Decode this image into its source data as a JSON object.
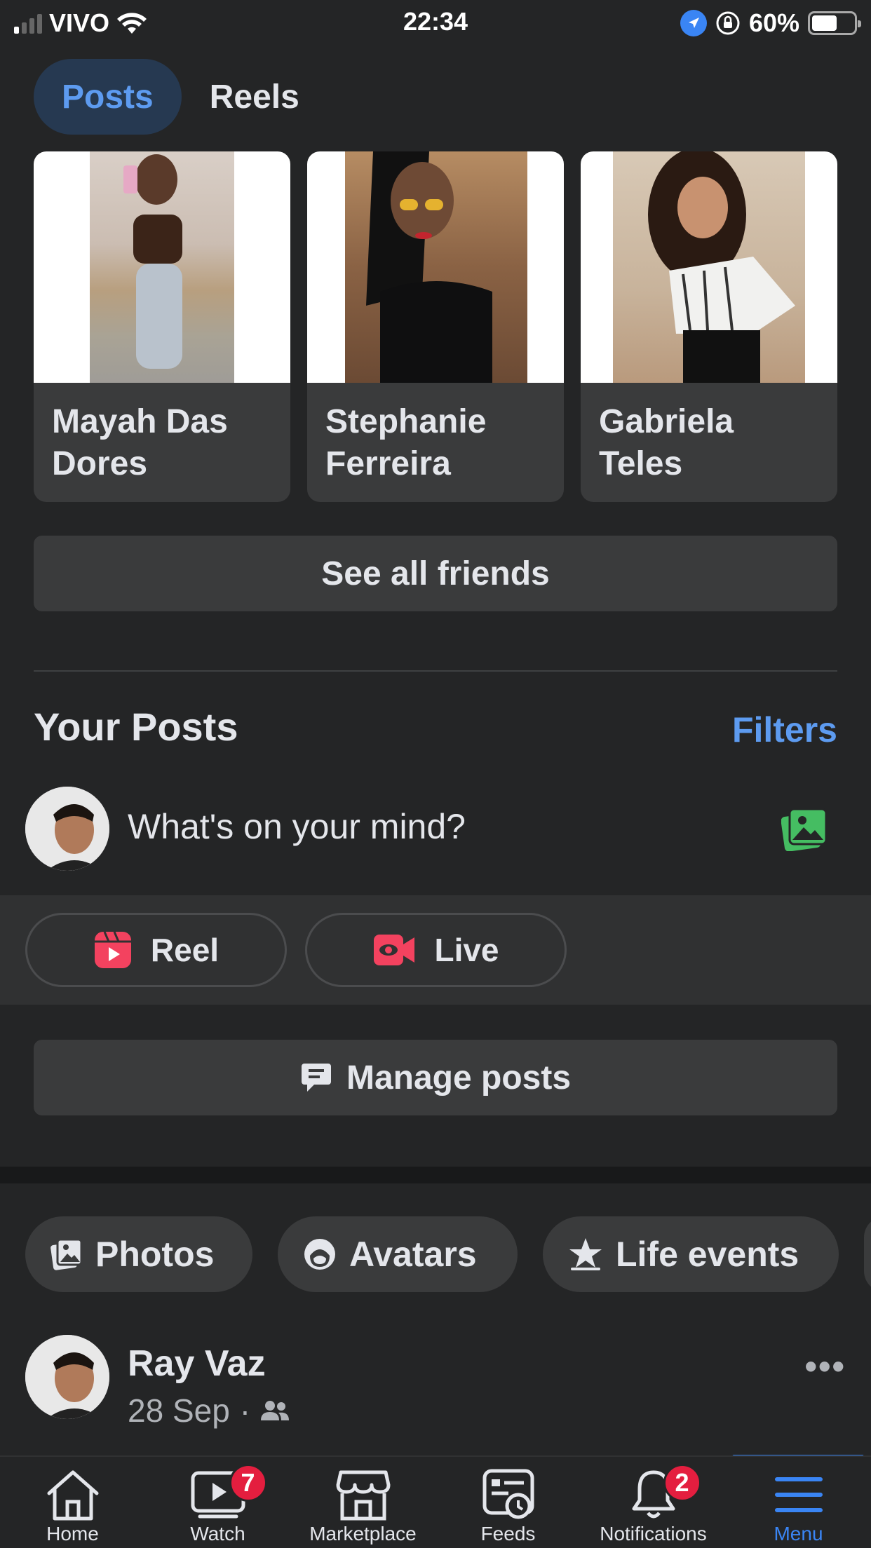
{
  "status_bar": {
    "carrier": "VIVO",
    "time": "22:34",
    "battery": "60%",
    "battery_level": 0.6
  },
  "tabs": [
    {
      "label": "Posts",
      "active": true
    },
    {
      "label": "Reels",
      "active": false
    }
  ],
  "friends": [
    {
      "name_line1": "Mayah Das",
      "name_line2": "Dores"
    },
    {
      "name_line1": "Stephanie",
      "name_line2": "Ferreira"
    },
    {
      "name_line1": "Gabriela",
      "name_line2": "Teles"
    }
  ],
  "see_all_friends": "See all friends",
  "your_posts": {
    "title": "Your Posts",
    "filters": "Filters"
  },
  "composer": {
    "placeholder": "What's on your mind?"
  },
  "actions": {
    "reel": "Reel",
    "live": "Live"
  },
  "manage_posts": "Manage posts",
  "chips": [
    {
      "label": "Photos"
    },
    {
      "label": "Avatars"
    },
    {
      "label": "Life events"
    }
  ],
  "post": {
    "author": "Ray Vaz",
    "date": "28 Sep",
    "separator": "·"
  },
  "bottom_nav": [
    {
      "label": "Home"
    },
    {
      "label": "Watch",
      "badge": "7"
    },
    {
      "label": "Marketplace"
    },
    {
      "label": "Feeds"
    },
    {
      "label": "Notifications",
      "badge": "2"
    },
    {
      "label": "Menu",
      "active": true
    }
  ],
  "colors": {
    "background": "#242526",
    "card": "#3a3b3c",
    "accent": "#5d9bf0",
    "badge": "#e41e3f",
    "reel_icon": "#f3425f",
    "photo_icon": "#45bd62"
  }
}
